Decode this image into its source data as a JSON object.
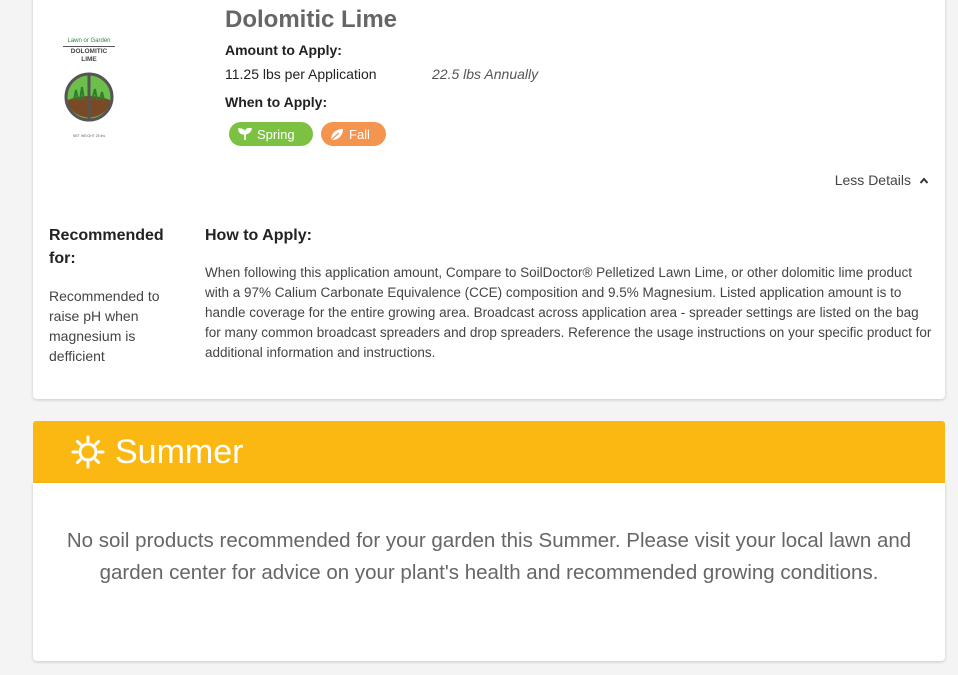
{
  "product": {
    "title": "Dolomitic Lime",
    "image": {
      "brand": "Lawn or Garden",
      "name_line1": "DOLOMITIC",
      "name_line2": "LIME",
      "net_weight": "NET WEIGHT 25 lbs"
    },
    "amount_label": "Amount to Apply:",
    "amount_value": "11.25 lbs per Application",
    "annual_value": "22.5 lbs Annually",
    "when_label": "When to Apply:",
    "seasons": [
      {
        "label": "Spring",
        "icon": "sprout-icon",
        "color": "#7cc142"
      },
      {
        "label": "Fall",
        "icon": "leaf-icon",
        "color": "#f4954f"
      }
    ],
    "less_details": "Less Details",
    "recommended_heading": "Recommended for:",
    "recommended_text": "Recommended to raise pH when magnesium is defficient",
    "howto_heading": "How to Apply:",
    "howto_text": "When following this application amount, Compare to SoilDoctor® Pelletized Lawn Lime, or other dolomitic lime product with a 97% Calium Carbonate Equivalence (CCE) composition and 9.5% Magnesium. Listed application amount is to handle coverage for the entire growing area. Broadcast across application area - spreader settings are listed on the bag for many common broadcast spreaders and drop spreaders. Reference the usage instructions on your specific product for additional information and instructions."
  },
  "summer": {
    "title": "Summer",
    "icon": "sun-icon",
    "color": "#fbb812",
    "message": "No soil products recommended for your garden this Summer. Please visit your local lawn and garden center for advice on your plant's health and recommended growing conditions."
  }
}
